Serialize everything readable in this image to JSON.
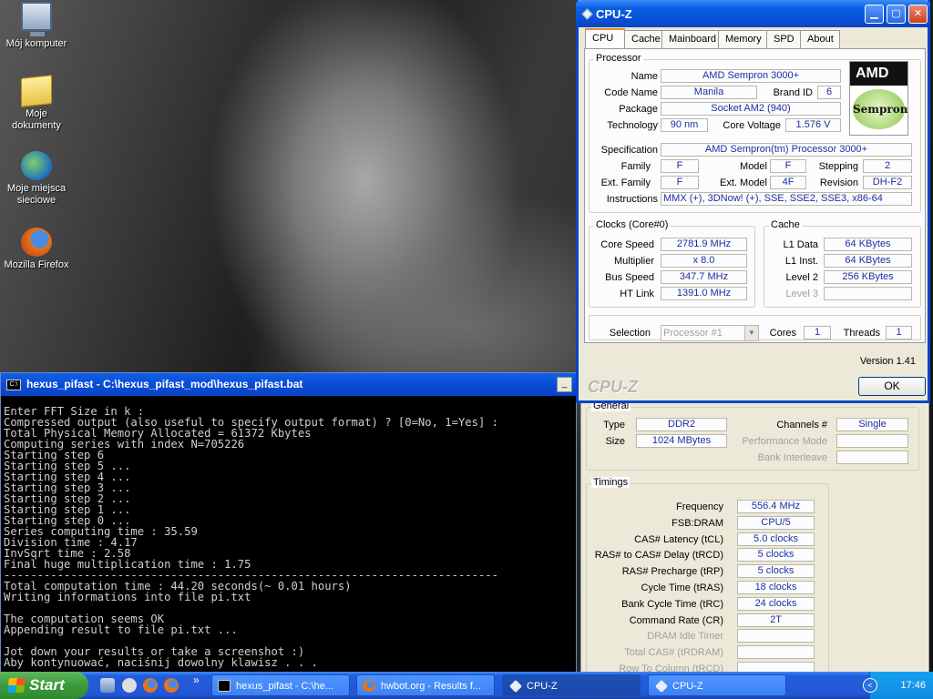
{
  "desktop": {
    "icons": [
      {
        "label": "Mój komputer"
      },
      {
        "label": "Moje dokumenty"
      },
      {
        "label": "Moje miejsca sieciowe"
      },
      {
        "label": "Mozilla Firefox"
      }
    ]
  },
  "console": {
    "title": "hexus_pifast - C:\\hexus_pifast_mod\\hexus_pifast.bat",
    "minimize": "_",
    "text": "Enter FFT Size in k :\nCompressed output (also useful to specify output format) ? [0=No, 1=Yes] :\nTotal Physical Memory Allocated = 61372 Kbytes\nComputing series with index N=705226\nStarting step 6\nStarting step 5 ...\nStarting step 4 ...\nStarting step 3 ...\nStarting step 2 ...\nStarting step 1 ...\nStarting step 0 ...\nSeries computing time : 35.59\nDivision time : 4.17\nInvSqrt time : 2.58\nFinal huge multiplication time : 1.75\n--------------------------------------------------------------------------\nTotal computation time : 44.20 seconds(~ 0.01 hours)\nWriting informations into file pi.txt\n\nThe computation seems OK\nAppending result to file pi.txt ...\n\nJot down your results or take a screenshot :)\nAby kontynuować, naciśnij dowolny klawisz . . ."
  },
  "cpuz_main": {
    "title": "CPU-Z",
    "tabs": [
      "CPU",
      "Cache",
      "Mainboard",
      "Memory",
      "SPD",
      "About"
    ],
    "processor": {
      "group": "Processor",
      "name_label": "Name",
      "name": "AMD Sempron 3000+",
      "codename_label": "Code Name",
      "codename": "Manila",
      "brandid_label": "Brand ID",
      "brandid": "6",
      "package_label": "Package",
      "package": "Socket AM2 (940)",
      "technology_label": "Technology",
      "technology": "90 nm",
      "voltage_label": "Core Voltage",
      "voltage": "1.576 V",
      "spec_label": "Specification",
      "spec": "AMD Sempron(tm) Processor 3000+",
      "family_label": "Family",
      "family": "F",
      "model_label": "Model",
      "model": "F",
      "stepping_label": "Stepping",
      "stepping": "2",
      "extfamily_label": "Ext. Family",
      "extfamily": "F",
      "extmodel_label": "Ext. Model",
      "extmodel": "4F",
      "revision_label": "Revision",
      "revision": "DH-F2",
      "instr_label": "Instructions",
      "instructions": "MMX (+), 3DNow! (+), SSE, SSE2, SSE3, x86-64",
      "logo_brand": "AMD",
      "logo_product": "Sempron"
    },
    "clocks": {
      "group": "Clocks (Core#0)",
      "core_speed_label": "Core Speed",
      "core_speed": "2781.9 MHz",
      "multiplier_label": "Multiplier",
      "multiplier": "x 8.0",
      "bus_speed_label": "Bus Speed",
      "bus_speed": "347.7 MHz",
      "ht_link_label": "HT Link",
      "ht_link": "1391.0 MHz"
    },
    "cache": {
      "group": "Cache",
      "l1d_label": "L1 Data",
      "l1d": "64 KBytes",
      "l1i_label": "L1 Inst.",
      "l1i": "64 KBytes",
      "l2_label": "Level 2",
      "l2": "256 KBytes",
      "l3_label": "Level 3",
      "l3": ""
    },
    "selection": {
      "label": "Selection",
      "value": "Processor #1",
      "cores_label": "Cores",
      "cores": "1",
      "threads_label": "Threads",
      "threads": "1"
    },
    "version": "Version 1.41",
    "brand": "CPU-Z",
    "ok": "OK"
  },
  "cpuz_memory": {
    "general": {
      "group": "General",
      "type_label": "Type",
      "type": "DDR2",
      "size_label": "Size",
      "size": "1024 MBytes",
      "channels_label": "Channels #",
      "channels": "Single",
      "perf_label": "Performance Mode",
      "perf": "",
      "bank_label": "Bank Interleave",
      "bank": ""
    },
    "timings": {
      "group": "Timings",
      "rows": [
        {
          "label": "Frequency",
          "value": "556.4 MHz"
        },
        {
          "label": "FSB:DRAM",
          "value": "CPU/5"
        },
        {
          "label": "CAS# Latency (tCL)",
          "value": "5.0 clocks"
        },
        {
          "label": "RAS# to CAS# Delay (tRCD)",
          "value": "5 clocks"
        },
        {
          "label": "RAS# Precharge (tRP)",
          "value": "5 clocks"
        },
        {
          "label": "Cycle Time (tRAS)",
          "value": "18 clocks"
        },
        {
          "label": "Bank Cycle Time (tRC)",
          "value": "24 clocks"
        },
        {
          "label": "Command Rate (CR)",
          "value": "2T"
        },
        {
          "label": "DRAM Idle Timer",
          "value": ""
        },
        {
          "label": "Total CAS# (tRDRAM)",
          "value": ""
        },
        {
          "label": "Row To Column (tRCD)",
          "value": ""
        }
      ]
    }
  },
  "taskbar": {
    "start": "Start",
    "quicklaunch_more": "»",
    "tasks": [
      {
        "label": "hexus_pifast - C:\\he..."
      },
      {
        "label": "hwbot.org - Results f..."
      },
      {
        "label": "CPU-Z"
      },
      {
        "label": "CPU-Z"
      }
    ],
    "clock": "17:46"
  },
  "colors": {
    "titlebar": "#0a5fe6",
    "field_text": "#1b2fa0",
    "taskbar": "#245edb",
    "start": "#3c9a3c"
  }
}
